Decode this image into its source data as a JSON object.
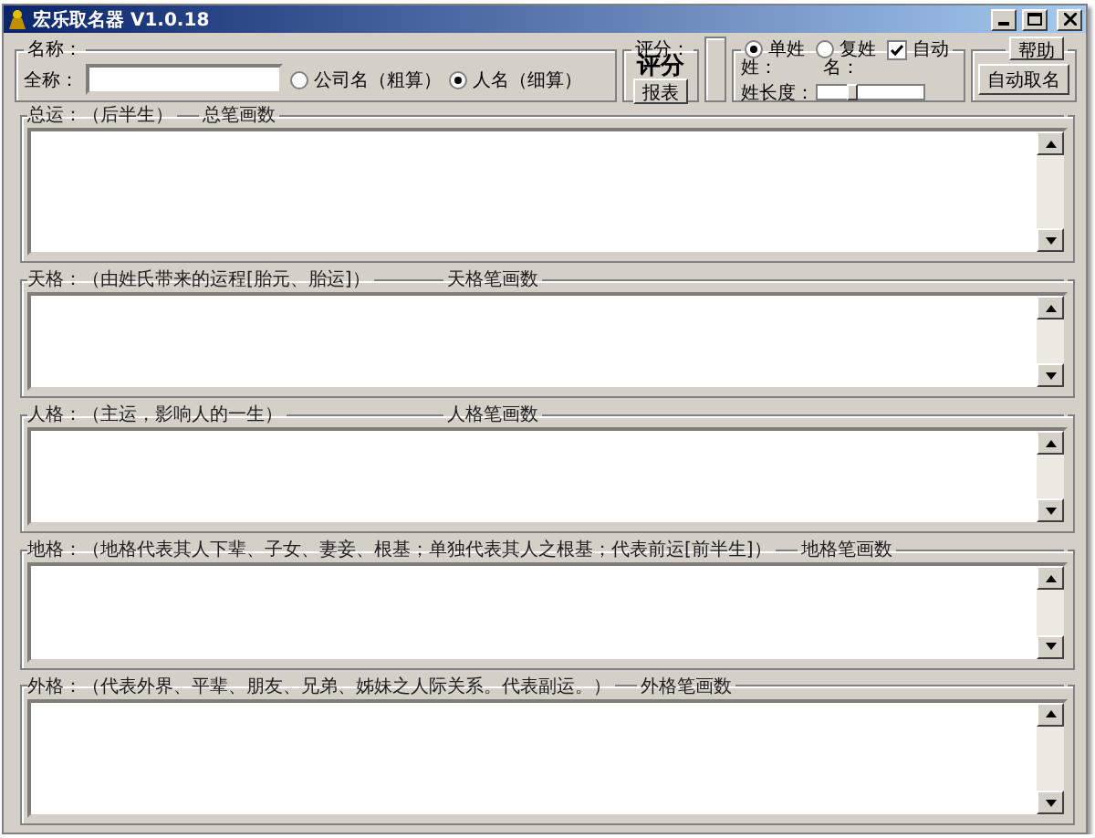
{
  "window": {
    "title": "宏乐取名器 V1.0.18"
  },
  "name_group": {
    "legend": "名称：",
    "full_name_label": "全称："
  },
  "name_type": [
    {
      "label": "公司名（粗算）",
      "selected": false
    },
    {
      "label": "人名（细算）",
      "selected": true
    }
  ],
  "score": {
    "legend": "评分：",
    "value": "评分",
    "report_button": "报表"
  },
  "surname_type": [
    {
      "label": "单姓",
      "selected": true
    },
    {
      "label": "复姓",
      "selected": false
    }
  ],
  "auto": {
    "label": "自动",
    "checked": true
  },
  "surname_label": "姓：",
  "given_label": "名：",
  "surname_length": {
    "label": "姓长度：",
    "level": 0.3
  },
  "help_button": "帮助",
  "auto_name_button": "自动取名",
  "sections": [
    {
      "label": "总运：（后半生）",
      "count_label": "总笔画数"
    },
    {
      "label": "天格：（由姓氏带来的运程[胎元、胎运]）",
      "count_label": "天格笔画数"
    },
    {
      "label": "人格：（主运，影响人的一生）",
      "count_label": "人格笔画数"
    },
    {
      "label": "地格：（地格代表其人下辈、子女、妻妾、根基；单独代表其人之根基；代表前运[前半生]）",
      "count_label": "地格笔画数"
    },
    {
      "label": "外格：（代表外界、平辈、朋友、兄弟、姊妹之人际关系。代表副运。）",
      "count_label": "外格笔画数"
    }
  ]
}
